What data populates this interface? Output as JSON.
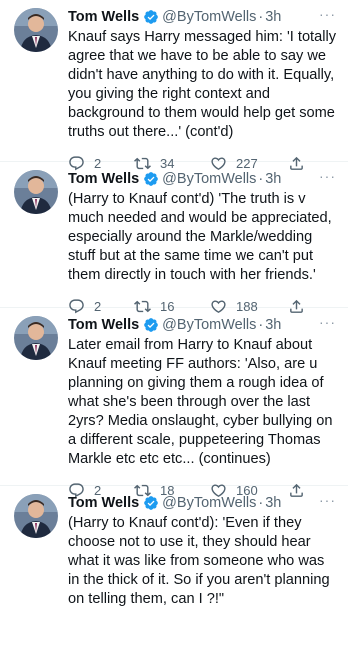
{
  "author": {
    "name": "Tom Wells",
    "handle": "@ByTomWells",
    "separator": "·",
    "more_label": "···",
    "icons": {
      "verified": "verified-badge-icon",
      "reply": "reply-icon",
      "retweet": "retweet-icon",
      "like": "heart-icon",
      "share": "share-icon"
    },
    "colors": {
      "verified": "#1d9bf0",
      "muted": "#536471"
    }
  },
  "tweets": [
    {
      "time": "3h",
      "text": "Knauf says Harry messaged him: 'I totally agree that we have to be able to say we didn't have anything to do with it. Equally, you giving the right context and background to them would help get some truths out there...' (cont'd)",
      "replies": "2",
      "retweets": "34",
      "likes": "227"
    },
    {
      "time": "3h",
      "text": "(Harry to Knauf cont'd) 'The truth is v much needed and would be appreciated, especially around the Markle/wedding stuff but at the same time we can't put them directly in touch with her friends.'",
      "replies": "2",
      "retweets": "16",
      "likes": "188"
    },
    {
      "time": "3h",
      "text": "Later email from Harry to Knauf about Knauf meeting FF authors: 'Also, are u planning on giving them a rough idea of what she's been through over the last 2yrs? Media onslaught, cyber bullying on a different scale, puppeteering Thomas Markle etc etc etc... (continues)",
      "replies": "2",
      "retweets": "18",
      "likes": "160"
    },
    {
      "time": "3h",
      "text": "(Harry to Knauf cont'd): 'Even if they choose not to use it, they should hear what it was like from someone who was in the thick of it. So if you aren't planning on telling them, can I ?!\"",
      "replies": "",
      "retweets": "",
      "likes": ""
    }
  ]
}
